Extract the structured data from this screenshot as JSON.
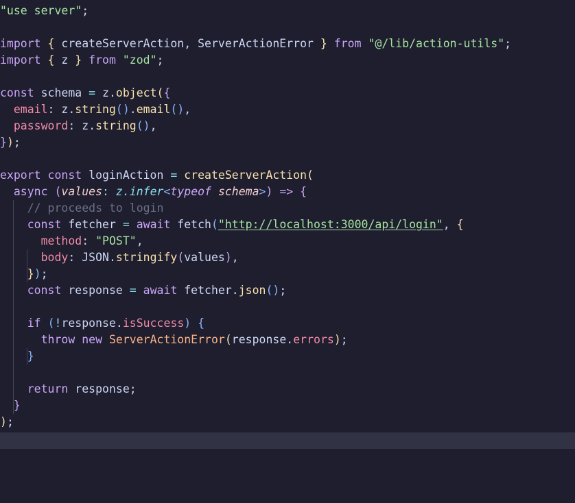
{
  "editor": {
    "theme": {
      "background": "#1e1e2e",
      "current_line": "#313244",
      "indent_guide": "#45475a",
      "colors": {
        "plain": "#cdd6f4",
        "keyword": "#cba6f7",
        "string": "#a6e3a1",
        "function": "#f9e2af",
        "property": "#f38ba8",
        "method": "#89b4fa",
        "comment": "#6c7086",
        "type": "#89dceb",
        "param": "#f2cdcd",
        "operator": "#89dceb",
        "bracket1": "#f9e2af",
        "bracket2": "#cba6f7",
        "bracket3": "#89b4fa",
        "punct": "#9399b2",
        "class": "#fab387"
      }
    },
    "lines": [
      [
        [
          "string",
          "\"use server\""
        ],
        [
          "plain",
          ";"
        ]
      ],
      [],
      [
        [
          "keyword",
          "import"
        ],
        [
          "plain",
          " "
        ],
        [
          "bracket1",
          "{"
        ],
        [
          "plain",
          " createServerAction, ServerActionError "
        ],
        [
          "bracket1",
          "}"
        ],
        [
          "plain",
          " "
        ],
        [
          "keyword",
          "from"
        ],
        [
          "plain",
          " "
        ],
        [
          "string",
          "\"@/lib/action-utils\""
        ],
        [
          "plain",
          ";"
        ]
      ],
      [
        [
          "keyword",
          "import"
        ],
        [
          "plain",
          " "
        ],
        [
          "bracket1",
          "{"
        ],
        [
          "plain",
          " z "
        ],
        [
          "bracket1",
          "}"
        ],
        [
          "plain",
          " "
        ],
        [
          "keyword",
          "from"
        ],
        [
          "plain",
          " "
        ],
        [
          "string",
          "\"zod\""
        ],
        [
          "plain",
          ";"
        ]
      ],
      [],
      [
        [
          "keyword",
          "const"
        ],
        [
          "plain",
          " schema "
        ],
        [
          "operator",
          "="
        ],
        [
          "plain",
          " z."
        ],
        [
          "function",
          "object"
        ],
        [
          "bracket1",
          "("
        ],
        [
          "bracket2",
          "{"
        ]
      ],
      [
        [
          "plain",
          "  "
        ],
        [
          "property",
          "email"
        ],
        [
          "plain",
          ": z."
        ],
        [
          "function",
          "string"
        ],
        [
          "bracket3",
          "()"
        ],
        [
          "plain",
          "."
        ],
        [
          "function",
          "email"
        ],
        [
          "bracket3",
          "()"
        ],
        [
          "plain",
          ","
        ]
      ],
      [
        [
          "plain",
          "  "
        ],
        [
          "property",
          "password"
        ],
        [
          "plain",
          ": z."
        ],
        [
          "function",
          "string"
        ],
        [
          "bracket3",
          "()"
        ],
        [
          "plain",
          ","
        ]
      ],
      [
        [
          "bracket2",
          "}"
        ],
        [
          "bracket1",
          ")"
        ],
        [
          "plain",
          ";"
        ]
      ],
      [],
      [
        [
          "keyword",
          "export"
        ],
        [
          "plain",
          " "
        ],
        [
          "keyword",
          "const"
        ],
        [
          "plain",
          " loginAction "
        ],
        [
          "operator",
          "="
        ],
        [
          "plain",
          " "
        ],
        [
          "function",
          "createServerAction"
        ],
        [
          "bracket1",
          "("
        ]
      ],
      [
        [
          "plain",
          "  "
        ],
        [
          "keyword",
          "async"
        ],
        [
          "plain",
          " "
        ],
        [
          "bracket2",
          "("
        ],
        [
          "param",
          "values"
        ],
        [
          "operator",
          ":"
        ],
        [
          "plain",
          " "
        ],
        [
          "type",
          "z.infer"
        ],
        [
          "bracket3",
          "<"
        ],
        [
          "keyword",
          "typeof"
        ],
        [
          "plain",
          " "
        ],
        [
          "param",
          "schema"
        ],
        [
          "bracket3",
          ">"
        ],
        [
          "bracket2",
          ")"
        ],
        [
          "plain",
          " "
        ],
        [
          "keyword",
          "=>"
        ],
        [
          "plain",
          " "
        ],
        [
          "bracket2",
          "{"
        ]
      ],
      [
        [
          "plain",
          "    "
        ],
        [
          "comment",
          "// proceeds to login"
        ]
      ],
      [
        [
          "plain",
          "    "
        ],
        [
          "keyword",
          "const"
        ],
        [
          "plain",
          " fetcher "
        ],
        [
          "operator",
          "="
        ],
        [
          "plain",
          " "
        ],
        [
          "keyword",
          "await"
        ],
        [
          "plain",
          " fetch"
        ],
        [
          "bracket3",
          "("
        ],
        [
          "link",
          "\"http://localhost:3000/api/login\""
        ],
        [
          "plain",
          ", "
        ],
        [
          "bracket1",
          "{"
        ]
      ],
      [
        [
          "plain",
          "      "
        ],
        [
          "property",
          "method"
        ],
        [
          "plain",
          ": "
        ],
        [
          "string",
          "\"POST\""
        ],
        [
          "plain",
          ","
        ]
      ],
      [
        [
          "plain",
          "      "
        ],
        [
          "property",
          "body"
        ],
        [
          "plain",
          ": JSON."
        ],
        [
          "function",
          "stringify"
        ],
        [
          "bracket2",
          "("
        ],
        [
          "plain",
          "values"
        ],
        [
          "bracket2",
          ")"
        ],
        [
          "plain",
          ","
        ]
      ],
      [
        [
          "plain",
          "    "
        ],
        [
          "bracket1",
          "}"
        ],
        [
          "bracket3",
          ")"
        ],
        [
          "plain",
          ";"
        ]
      ],
      [
        [
          "plain",
          "    "
        ],
        [
          "keyword",
          "const"
        ],
        [
          "plain",
          " response "
        ],
        [
          "operator",
          "="
        ],
        [
          "plain",
          " "
        ],
        [
          "keyword",
          "await"
        ],
        [
          "plain",
          " fetcher."
        ],
        [
          "function",
          "json"
        ],
        [
          "bracket3",
          "()"
        ],
        [
          "plain",
          ";"
        ]
      ],
      [],
      [
        [
          "plain",
          "    "
        ],
        [
          "keyword",
          "if"
        ],
        [
          "plain",
          " "
        ],
        [
          "bracket3",
          "("
        ],
        [
          "operator",
          "!"
        ],
        [
          "plain",
          "response."
        ],
        [
          "property",
          "isSuccess"
        ],
        [
          "bracket3",
          ")"
        ],
        [
          "plain",
          " "
        ],
        [
          "bracket3",
          "{"
        ]
      ],
      [
        [
          "plain",
          "      "
        ],
        [
          "keyword",
          "throw"
        ],
        [
          "plain",
          " "
        ],
        [
          "keyword",
          "new"
        ],
        [
          "plain",
          " "
        ],
        [
          "class",
          "ServerActionError"
        ],
        [
          "bracket1",
          "("
        ],
        [
          "plain",
          "response."
        ],
        [
          "property",
          "errors"
        ],
        [
          "bracket1",
          ")"
        ],
        [
          "plain",
          ";"
        ]
      ],
      [
        [
          "plain",
          "    "
        ],
        [
          "bracket3",
          "}"
        ]
      ],
      [],
      [
        [
          "plain",
          "    "
        ],
        [
          "keyword",
          "return"
        ],
        [
          "plain",
          " response;"
        ]
      ],
      [
        [
          "plain",
          "  "
        ],
        [
          "bracket2",
          "}"
        ]
      ],
      [
        [
          "bracket1",
          ")"
        ],
        [
          "plain",
          ";"
        ]
      ],
      []
    ]
  }
}
